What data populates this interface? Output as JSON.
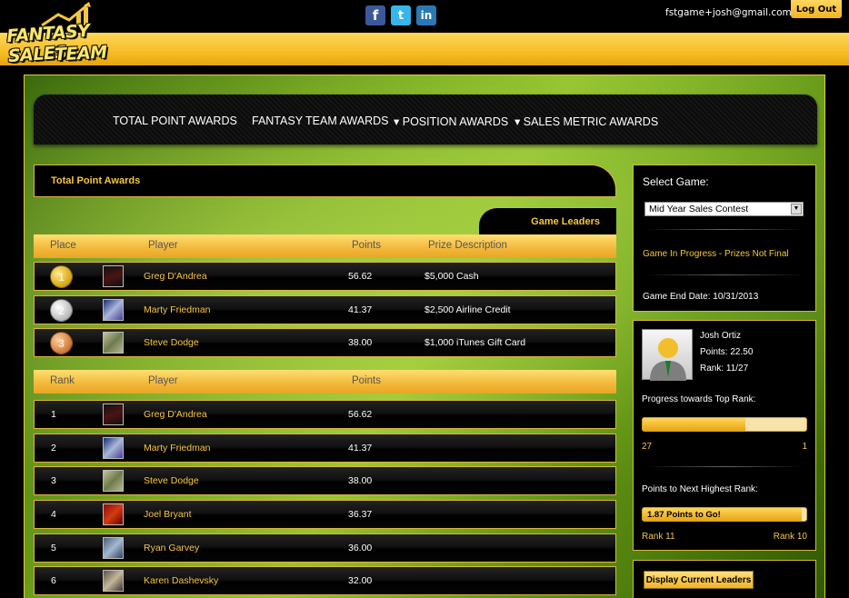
{
  "header": {
    "logo_line1": "FANTASY SALES",
    "logo_line2": "TEAM",
    "email": "fstgame+josh@gmail.com",
    "logout_label": "Log Out",
    "social": [
      {
        "icon": "facebook-icon",
        "glyph": "f"
      },
      {
        "icon": "twitter-icon",
        "glyph": "t"
      },
      {
        "icon": "linkedin-icon",
        "glyph": "in"
      }
    ]
  },
  "nav": {
    "items": [
      {
        "label": "TOTAL POINT AWARDS"
      },
      {
        "label": "FANTASY TEAM AWARDS"
      },
      {
        "label": "▾ POSITION AWARDS"
      },
      {
        "label": "▾ SALES METRIC AWARDS"
      }
    ]
  },
  "panel": {
    "title": "Total Point Awards",
    "tab": "Game Leaders",
    "leaders_header": {
      "place": "Place",
      "player": "Player",
      "points": "Points",
      "prize": "Prize Description"
    },
    "leaders": [
      {
        "medal": "1",
        "player": "Greg D'Andrea",
        "points": "56.62",
        "prize": "$5,000 Cash"
      },
      {
        "medal": "2",
        "player": "Marty Friedman",
        "points": "41.37",
        "prize": "$2,500 Airline Credit"
      },
      {
        "medal": "3",
        "player": "Steve Dodge",
        "points": "38.00",
        "prize": "$1,000 iTunes Gift Card"
      }
    ],
    "rank_header": {
      "rank": "Rank",
      "player": "Player",
      "points": "Points"
    },
    "ranks": [
      {
        "rank": "1",
        "player": "Greg D'Andrea",
        "points": "56.62"
      },
      {
        "rank": "2",
        "player": "Marty Friedman",
        "points": "41.37"
      },
      {
        "rank": "3",
        "player": "Steve Dodge",
        "points": "38.00"
      },
      {
        "rank": "4",
        "player": "Joel Bryant",
        "points": "36.37"
      },
      {
        "rank": "5",
        "player": "Ryan Garvey",
        "points": "36.00"
      },
      {
        "rank": "6",
        "player": "Karen Dashevsky",
        "points": "32.00"
      }
    ]
  },
  "game": {
    "select_label": "Select Game:",
    "selected_game": "Mid Year Sales Contest",
    "status": "Game In Progress - Prizes Not Final",
    "end_date": "Game End Date: 10/31/2013"
  },
  "profile": {
    "name": "Josh Ortiz",
    "points": "Points: 22.50",
    "rank": "Rank: 11/27",
    "progress_label": "Progress towards Top Rank:",
    "progress_fraction": 0.63,
    "progress_left": "27",
    "progress_right": "1",
    "next_label": "Points to Next Highest Rank:",
    "next_text": "1.87 Points to Go!",
    "next_fraction": 0.97,
    "rank_left": "Rank 11",
    "rank_right": "Rank 10"
  },
  "leaders_button": "Display Current Leaders",
  "colors": {
    "accent": "#f7c63b",
    "band": "#f4b81d",
    "border": "#d9b640"
  }
}
